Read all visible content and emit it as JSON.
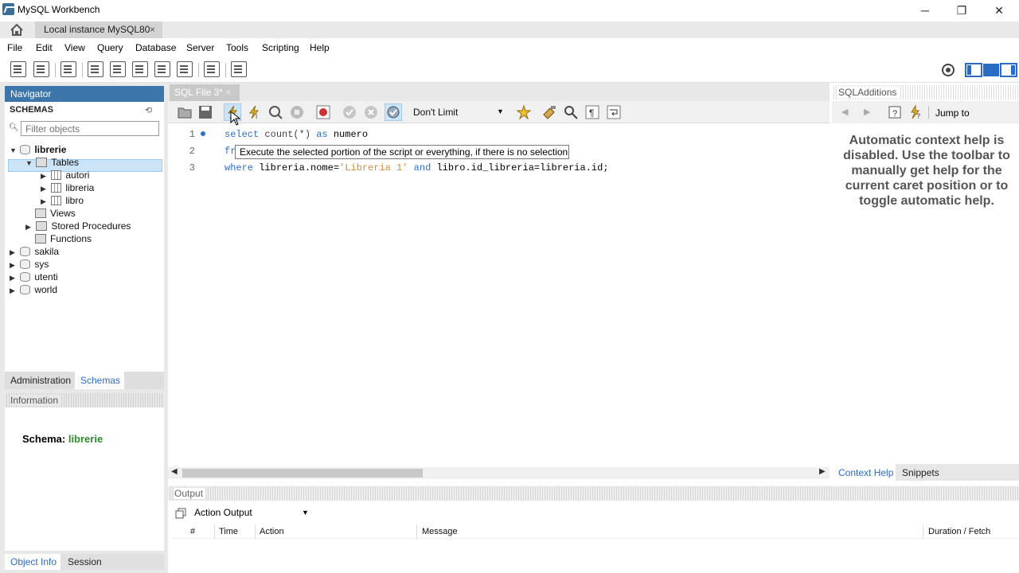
{
  "window": {
    "title": "MySQL Workbench",
    "minimize": "─",
    "restore": "❐",
    "close": "✕"
  },
  "tabs": {
    "document_tab": "Local instance MySQL80",
    "close": "×"
  },
  "menu": [
    "File",
    "Edit",
    "View",
    "Query",
    "Database",
    "Server",
    "Tools",
    "Scripting",
    "Help"
  ],
  "navigator": {
    "title": "Navigator",
    "schemas_label": "SCHEMAS",
    "filter_placeholder": "Filter objects",
    "tree": {
      "librerie": "librerie",
      "tables": "Tables",
      "autori": "autori",
      "libreria": "libreria",
      "libro": "libro",
      "views": "Views",
      "stored_procedures": "Stored Procedures",
      "functions": "Functions",
      "sakila": "sakila",
      "sys": "sys",
      "utenti": "utenti",
      "world": "world"
    },
    "tab_administration": "Administration",
    "tab_schemas": "Schemas"
  },
  "information": {
    "title": "Information",
    "schema_label": "Schema:",
    "schema_value": "librerie",
    "tab_object_info": "Object Info",
    "tab_session": "Session"
  },
  "editor": {
    "tab_label": "SQL File 3*",
    "limit": "Don't Limit",
    "lines": [
      "1",
      "2",
      "3"
    ],
    "code": {
      "l1_kw1": "select",
      "l1_fn": " count(*) ",
      "l1_kw2": "as",
      "l1_rest": " numero",
      "l2": "fr",
      "l3_kw": "where",
      "l3_a": " libreria.nome=",
      "l3_str": "'Libreria 1'",
      "l3_b": " ",
      "l3_kw2": "and",
      "l3_c": " libro.id_libreria=libreria.id;"
    },
    "tooltip": "Execute the selected portion of the script or everything, if there is no selection"
  },
  "sql_additions": {
    "title": "SQLAdditions",
    "jump_to": "Jump to",
    "help_text": "Automatic context help is disabled. Use the toolbar to manually get help for the current caret position or to toggle automatic help.",
    "tab_context_help": "Context Help",
    "tab_snippets": "Snippets"
  },
  "output": {
    "title": "Output",
    "selector": "Action Output",
    "columns": [
      "#",
      "Time",
      "Action",
      "Message",
      "Duration / Fetch"
    ]
  },
  "colors": {
    "accent": "#3b75aa",
    "selection": "#cce4f7",
    "keyword": "#2f6fc4",
    "string": "#d28c3a",
    "schema_green": "#2e8b2e"
  }
}
